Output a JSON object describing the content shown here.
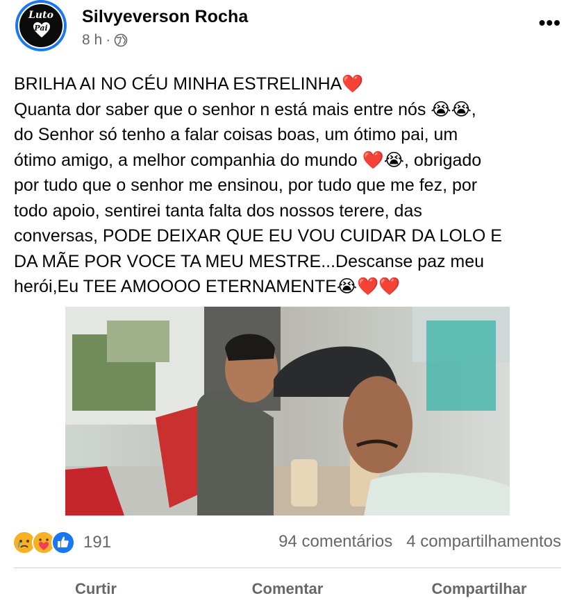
{
  "post": {
    "author": "Silvyeverson Rocha",
    "time": "8 h",
    "separator": "·",
    "privacy_icon": "globe-icon",
    "more_label": "•••",
    "avatar": {
      "line1": "Luto",
      "line2": "Pai",
      "colors": {
        "ring": "#1877f2",
        "background": "#0b0b0b"
      }
    },
    "text": "BRILHA AI NO CÉU MINHA ESTRELINHA❤️\nQuanta dor saber que o senhor n está mais entre nós 😭😭,\ndo Senhor só tenho a falar coisas boas, um ótimo pai, um\nótimo amigo, a melhor companhia do mundo ❤️😭, obrigado\npor tudo que o senhor me ensinou, por tudo que me fez, por\ntodo apoio, sentirei tanta falta dos nossos terere, das\nconversas, PODE DEIXAR QUE EU VOU CUIDAR DA LOLO E\nDA MÃE POR VOCE TA MEU MESTRE...Descanse paz meu\nherói,Eu TEE AMOOOO ETERNAMENTE😭❤️❤️"
  },
  "engagement": {
    "reaction_icons": [
      "sad-reaction-icon",
      "care-reaction-icon",
      "like-reaction-icon"
    ],
    "reaction_count": "191",
    "comments": "94 comentários",
    "shares": "4 compartilhamentos"
  },
  "actions": {
    "like": "Curtir",
    "comment": "Comentar",
    "share": "Compartilhar"
  },
  "colors": {
    "text": "#050505",
    "secondary": "#65676b",
    "accent": "#1877f2",
    "divider": "#ced0d4"
  }
}
